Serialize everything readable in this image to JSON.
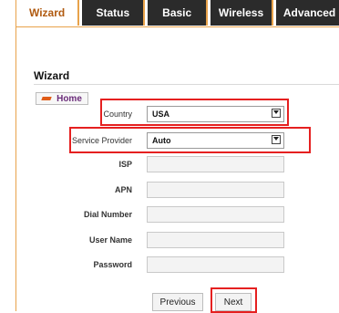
{
  "tabs": [
    "Wizard",
    "Status",
    "Basic",
    "Wireless",
    "Advanced"
  ],
  "page_title": "Wizard",
  "home_label": "Home",
  "form": {
    "country": {
      "label": "Country",
      "value": "USA"
    },
    "service_provider": {
      "label": "Service Provider",
      "value": "Auto"
    },
    "isp": {
      "label": "ISP",
      "value": ""
    },
    "apn": {
      "label": "APN",
      "value": ""
    },
    "dial_number": {
      "label": "Dial Number",
      "value": ""
    },
    "user_name": {
      "label": "User Name",
      "value": ""
    },
    "password": {
      "label": "Password",
      "value": ""
    }
  },
  "buttons": {
    "previous": "Previous",
    "next": "Next"
  },
  "colors": {
    "accent": "#e8a24a",
    "highlight": "#e52020",
    "tab_bg": "#2b2b2b"
  }
}
